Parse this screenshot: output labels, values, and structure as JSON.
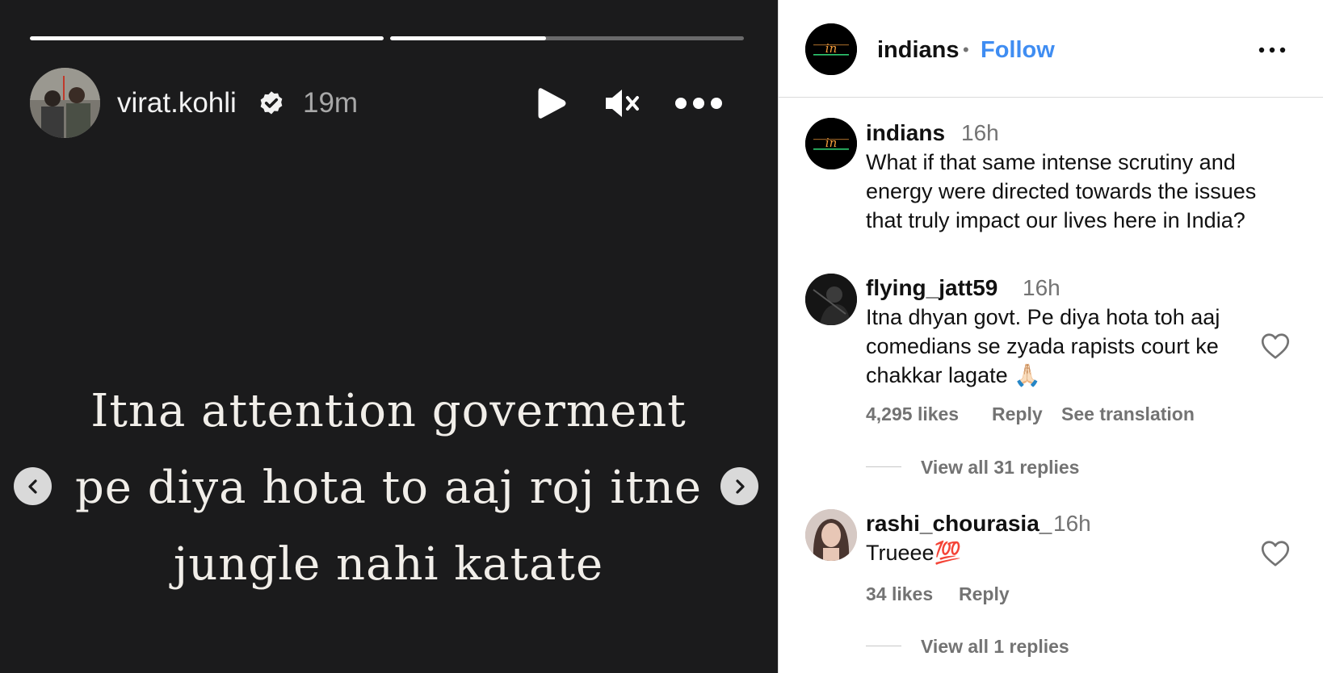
{
  "story": {
    "progress": [
      1.0,
      0.44
    ],
    "username": "virat.kohli",
    "verified": true,
    "time": "19m",
    "text_lines": [
      "Itna attention goverment",
      "pe diya hota to aaj roj itne",
      "jungle nahi katate"
    ],
    "icons": {
      "play": "play-icon",
      "mute": "muted-speaker-icon",
      "more": "more-horizontal-icon",
      "prev": "chevron-left-icon",
      "next": "chevron-right-icon",
      "verified": "verified-badge-icon"
    }
  },
  "post": {
    "account": "indians",
    "separator": "•",
    "follow_label": "Follow",
    "logo_text": "indians"
  },
  "comments": [
    {
      "user": "indians",
      "time": "16h",
      "lines": [
        "What if that same intense scrutiny and",
        "energy were directed towards the issues",
        "that truly impact our lives here in India?"
      ]
    },
    {
      "user": "flying_jatt59",
      "time": "16h",
      "lines": [
        "Itna dhyan govt. Pe diya hota toh aaj",
        "comedians se zyada rapists court ke",
        "chakkar lagate 🙏🏻"
      ],
      "likes": "4,295 likes",
      "reply_label": "Reply",
      "translate_label": "See translation",
      "view_replies": "View all 31 replies"
    },
    {
      "user": "rashi_chourasia_",
      "time": "16h",
      "lines": [
        "Trueee💯"
      ],
      "likes": "34 likes",
      "reply_label": "Reply",
      "view_replies": "View all 1 replies"
    }
  ],
  "colors": {
    "story_bg": "#1b1b1c",
    "follow": "#3f8df2",
    "muted_text": "#737373"
  }
}
